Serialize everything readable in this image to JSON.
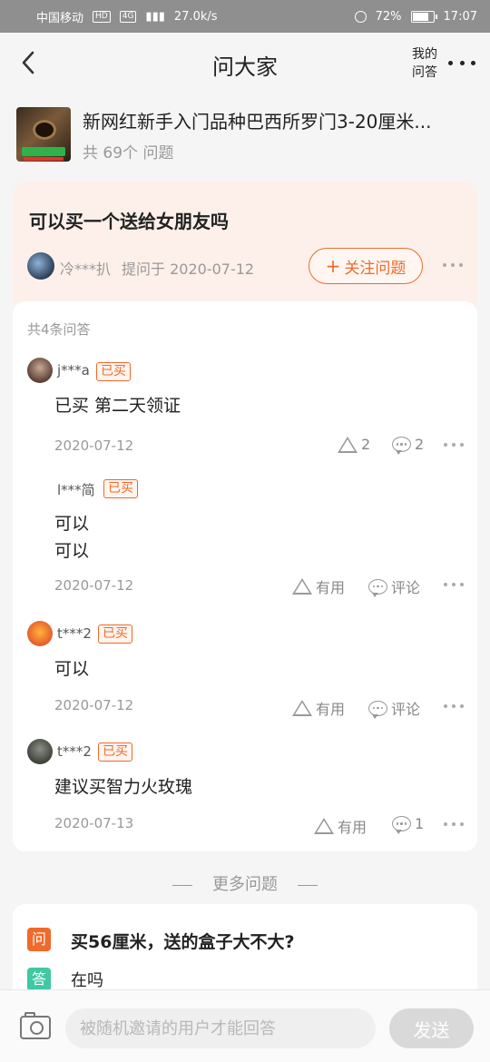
{
  "status_bar": {
    "carrier": "中国移动",
    "net_badges": [
      "HD",
      "4G"
    ],
    "speed": "27.0k/s",
    "battery": "72%",
    "time": "17:07"
  },
  "header": {
    "title": "问大家",
    "my_answers": "我的问答"
  },
  "product": {
    "name": "新网红新手入门品种巴西所罗门3-20厘米...",
    "question_count": "共 69个 问题"
  },
  "question": {
    "title": "可以买一个送给女朋友吗",
    "user": "冷***扒",
    "asked": "提问于 2020-07-12",
    "follow_label": "关注问题",
    "follow_plus": "+"
  },
  "answers": {
    "count_label": "共4条问答",
    "items": [
      {
        "user": "j***a",
        "tag": "已买",
        "text": "已买 第二天领证",
        "date": "2020-07-12",
        "like": "2",
        "comment": "2"
      },
      {
        "user": "l***简",
        "tag": "已买",
        "text": "可以\n可以",
        "date": "2020-07-12",
        "like": "有用",
        "comment": "评论"
      },
      {
        "user": "t***2",
        "tag": "已买",
        "text": "可以",
        "date": "2020-07-12",
        "like": "有用",
        "comment": "评论"
      },
      {
        "user": "t***2",
        "tag": "已买",
        "text": "建议买智力火玫瑰",
        "date": "2020-07-13",
        "like": "有用",
        "comment": "1"
      }
    ]
  },
  "more_questions": {
    "label": "更多问题",
    "q_badge": "问",
    "a_badge": "答",
    "title": "买56厘米，送的盒子大不大?",
    "answer": "在吗"
  },
  "bottom": {
    "placeholder": "被随机邀请的用户才能回答",
    "send": "发送"
  },
  "colors": {
    "accent": "#ef6a2b",
    "question_bg": "#fdf0ea",
    "answer_badge": "#3fc8a2"
  }
}
